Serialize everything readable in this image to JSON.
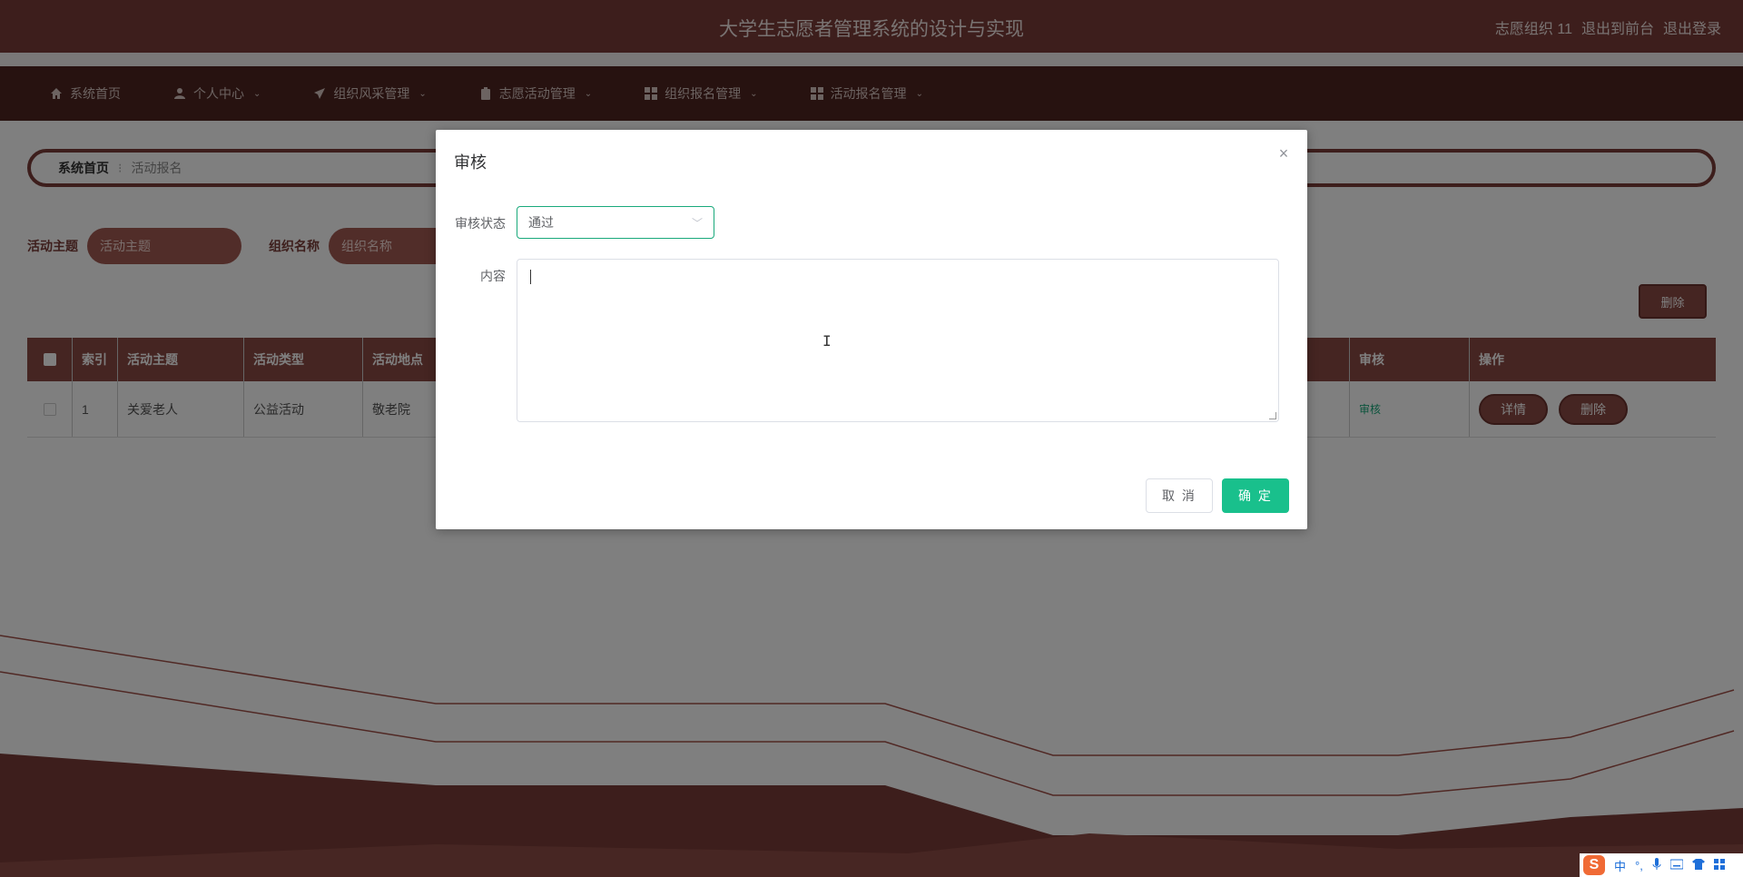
{
  "header": {
    "title": "大学生志愿者管理系统的设计与实现",
    "user": "志愿组织 11",
    "back_to_front": "退出到前台",
    "logout": "退出登录"
  },
  "nav": {
    "items": [
      {
        "label": "系统首页",
        "icon": "home-icon",
        "has_dropdown": false
      },
      {
        "label": "个人中心",
        "icon": "user-icon",
        "has_dropdown": true
      },
      {
        "label": "组织风采管理",
        "icon": "paper-plane-icon",
        "has_dropdown": true
      },
      {
        "label": "志愿活动管理",
        "icon": "clipboard-icon",
        "has_dropdown": true
      },
      {
        "label": "组织报名管理",
        "icon": "grid-icon",
        "has_dropdown": true
      },
      {
        "label": "活动报名管理",
        "icon": "grid-icon",
        "has_dropdown": true
      }
    ]
  },
  "breadcrumb": {
    "home": "系统首页",
    "separator": "⁝",
    "current": "活动报名"
  },
  "search": {
    "field1_label": "活动主题",
    "field1_placeholder": "活动主题",
    "field2_label": "组织名称",
    "field2_placeholder": "组织名称"
  },
  "toolbar": {
    "delete_label": "删除"
  },
  "table": {
    "headers": [
      "索引",
      "活动主题",
      "活动类型",
      "活动地点",
      "",
      "审核",
      "操作"
    ],
    "rows": [
      {
        "index": "1",
        "topic": "关爱老人",
        "type": "公益活动",
        "location": "敬老院",
        "audit": "审核",
        "detail": "详情",
        "delete": "删除"
      }
    ]
  },
  "dialog": {
    "title": "审核",
    "status_label": "审核状态",
    "status_value": "通过",
    "content_label": "内容",
    "content_value": "",
    "cancel_label": "取 消",
    "confirm_label": "确 定"
  },
  "tray": {
    "ime_logo": "S",
    "ime_mode": "中",
    "punct": "°,"
  },
  "colors": {
    "primary": "#7a3d38",
    "nav_bg": "#4f2521",
    "accent": "#19c08c",
    "button": "#8b4a44"
  }
}
